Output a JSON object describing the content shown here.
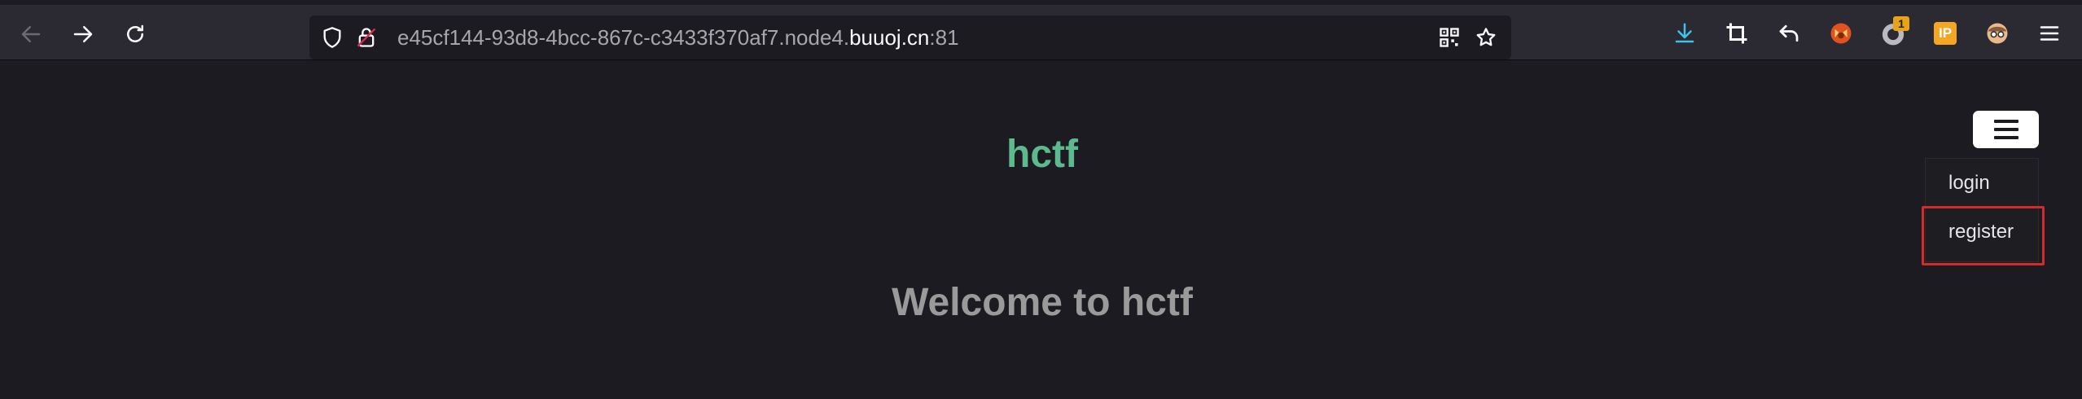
{
  "browser": {
    "url": {
      "prefix": "e45cf144-93d8-4bcc-867c-c3433f370af7.node4.",
      "host": "buuoj.cn",
      "suffix": ":81"
    },
    "toolbar_icons": [
      "back-icon",
      "forward-icon",
      "reload-icon",
      "shield-icon",
      "lock-warning-icon",
      "qr-code-icon",
      "bookmark-star-icon",
      "download-icon",
      "crop-icon",
      "undo-icon",
      "fox-extension-icon",
      "ring-extension-icon",
      "ip-extension-icon",
      "avatar-extension-icon",
      "menu-icon"
    ],
    "extension_badge": "1",
    "ip_label": "IP"
  },
  "page": {
    "brand": "hctf",
    "headline": "Welcome to hctf",
    "menu": {
      "items": [
        {
          "label": "login"
        },
        {
          "label": "register"
        }
      ]
    },
    "highlight_color": "#d32a2a",
    "brand_color": "#5dba8d"
  }
}
